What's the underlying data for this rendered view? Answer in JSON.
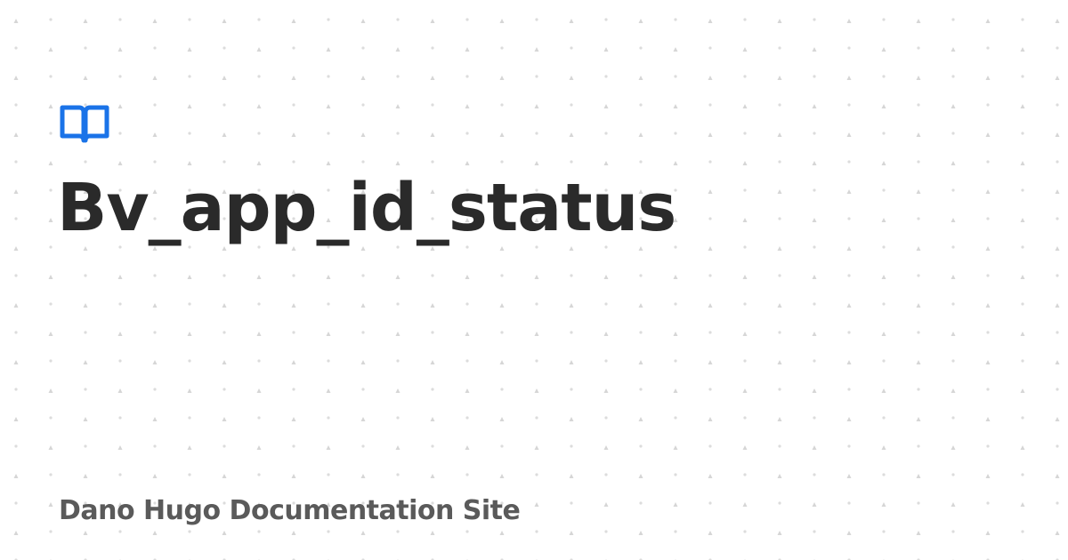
{
  "page": {
    "title": "Bv_app_id_status",
    "site_name": "Dano Hugo Documentation Site"
  },
  "logo": {
    "icon": "open-book-icon",
    "color": "#1a73e8"
  },
  "background": {
    "color": "#ffffff",
    "dot_color": "#d6d6d6",
    "pattern": "dotted-grid"
  }
}
